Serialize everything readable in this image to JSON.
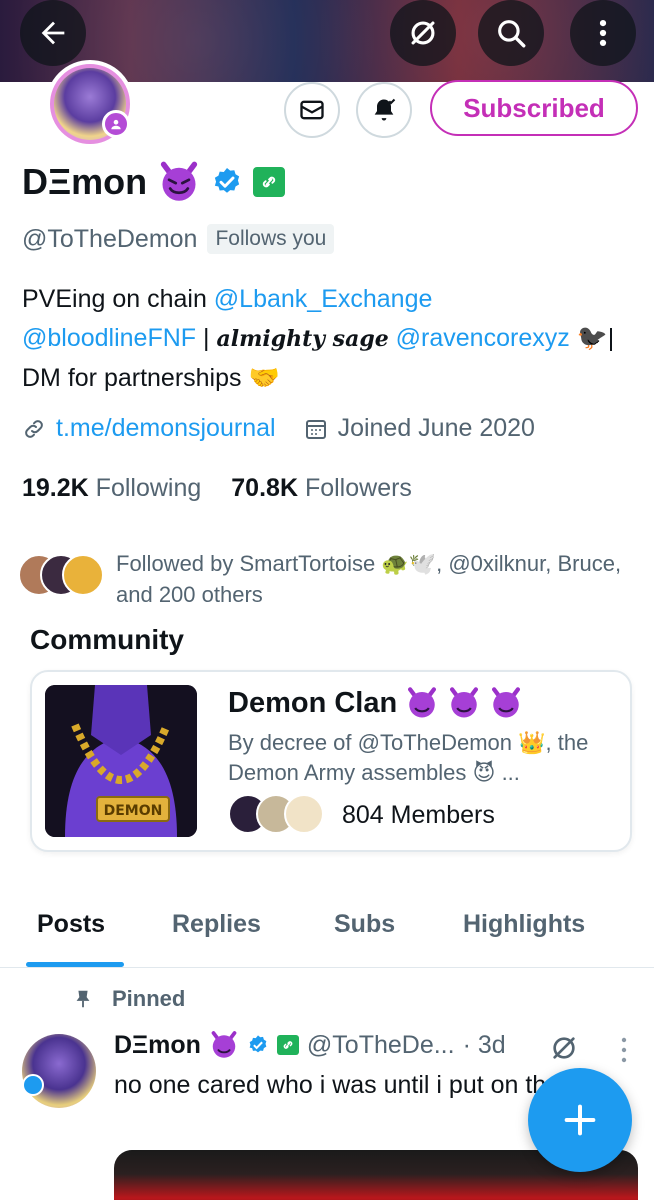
{
  "profile": {
    "display_name": "DΞmon",
    "handle": "@ToTheDemon",
    "follows_you": "Follows you",
    "bio": {
      "line1_prefix": "PVEing on chain ",
      "mention1": "@Lbank_Exchange",
      "mention2": "@bloodlineFNF",
      "separator": " | ",
      "gothic_text": "almighty sage",
      "mention3": "@ravencorexyz",
      "trailing": " 🐦‍⬛|",
      "line3": "DM for partnerships 🤝"
    },
    "website": "t.me/demonsjournal",
    "joined": "Joined June 2020",
    "following_count": "19.2K",
    "following_label": "Following",
    "followers_count": "70.8K",
    "followers_label": "Followers",
    "followed_by": "Followed by SmartTortoise 🐢🕊️, @0xilknur, Bruce, and 200 others"
  },
  "actions": {
    "subscribed_label": "Subscribed"
  },
  "community": {
    "section_title": "Community",
    "name": "Demon Clan",
    "description": "By decree of @ToTheDemon 👑, the Demon Army assembles 😈 ...",
    "members": "804 Members",
    "image_label": "DEMON"
  },
  "tabs": [
    {
      "label": "Posts"
    },
    {
      "label": "Replies"
    },
    {
      "label": "Subs"
    },
    {
      "label": "Highlights"
    }
  ],
  "pinned_post": {
    "pinned_label": "Pinned",
    "author_name": "DΞmon",
    "author_handle": "@ToTheDe...",
    "time": "· 3d",
    "text": "no one cared who i was until i put on the hat"
  },
  "colors": {
    "accent": "#1d9bf0",
    "subscribed": "#c42fb7",
    "verified": "#1d9bf0",
    "affiliate": "#20b25a"
  }
}
